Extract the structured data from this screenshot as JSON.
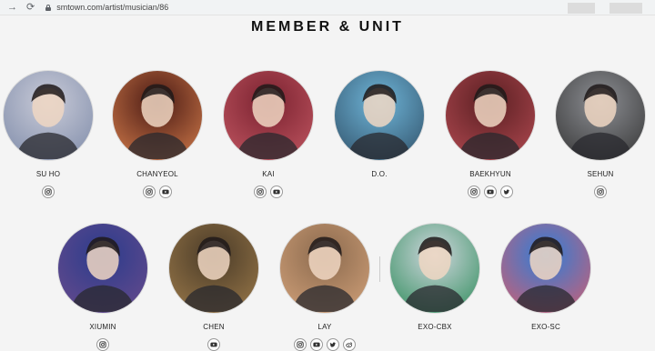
{
  "browser": {
    "url": "smtown.com/artist/musician/86"
  },
  "page": {
    "title": "MEMBER & UNIT"
  },
  "members": [
    {
      "name": "SU HO",
      "colors": [
        "#c9cbd8",
        "#7d8aa8"
      ],
      "socials": [
        "instagram-icon"
      ]
    },
    {
      "name": "CHANYEOL",
      "colors": [
        "#4a1a14",
        "#d47d4c"
      ],
      "socials": [
        "instagram-icon",
        "youtube-icon"
      ]
    },
    {
      "name": "KAI",
      "colors": [
        "#7a2230",
        "#c25762"
      ],
      "socials": [
        "instagram-icon",
        "youtube-icon"
      ]
    },
    {
      "name": "D.O.",
      "colors": [
        "#6fb5d8",
        "#2f4f67"
      ],
      "socials": []
    },
    {
      "name": "BAEKHYUN",
      "colors": [
        "#5a1f22",
        "#b34a52"
      ],
      "socials": [
        "instagram-icon",
        "youtube-icon",
        "twitter-icon"
      ]
    },
    {
      "name": "SEHUN",
      "colors": [
        "#8d8f94",
        "#333333"
      ],
      "socials": [
        "instagram-icon"
      ]
    },
    {
      "name": "XIUMIN",
      "colors": [
        "#2b3c8c",
        "#6a4b8c"
      ],
      "socials": [
        "instagram-icon"
      ]
    },
    {
      "name": "CHEN",
      "colors": [
        "#4a3b28",
        "#9c7a4a"
      ],
      "socials": [
        "youtube-icon"
      ]
    },
    {
      "name": "LAY",
      "colors": [
        "#8b6a4e",
        "#d3a27a"
      ],
      "socials": [
        "instagram-icon",
        "youtube-icon",
        "twitter-icon",
        "weibo-icon"
      ]
    },
    {
      "name": "EXO-CBX",
      "colors": [
        "#cfd6dd",
        "#2d8c5a"
      ],
      "socials": []
    },
    {
      "name": "EXO-SC",
      "colors": [
        "#2f7ed8",
        "#d35d6e"
      ],
      "socials": []
    }
  ]
}
